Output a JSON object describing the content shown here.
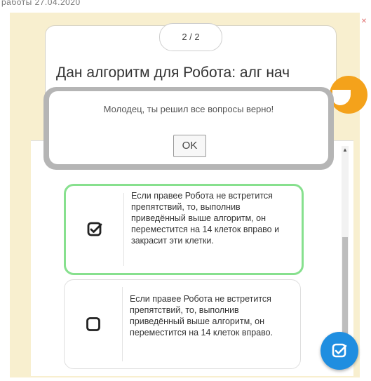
{
  "page": {
    "top_caption": "работы 27.04.2020",
    "corner_icon": "close-x-icon"
  },
  "question": {
    "counter": "2 / 2",
    "text": "Дан алгоритм для Робота: алг нач"
  },
  "mascot": {
    "icon": "smiley-emoji-icon"
  },
  "options": [
    {
      "checked": true,
      "text": "Если правее Робота не встретится препятствий, то, выполнив приведённый выше алгоритм, он переместится на 14 клеток вправо и закрасит эти клетки."
    },
    {
      "checked": false,
      "text": "Если правее Робота не встретится препятствий, то, выполнив приведённый выше алгоритм, он переместится на 14 клеток вправо."
    }
  ],
  "dialog": {
    "message": "Молодец, ты решил все вопросы верно!",
    "ok_label": "OK"
  },
  "fab": {
    "icon": "checkbox-icon"
  },
  "colors": {
    "background": "#f8efcf",
    "correct_border": "#87e08e",
    "fab": "#1f8ee0",
    "emoji": "#f4a21b"
  }
}
